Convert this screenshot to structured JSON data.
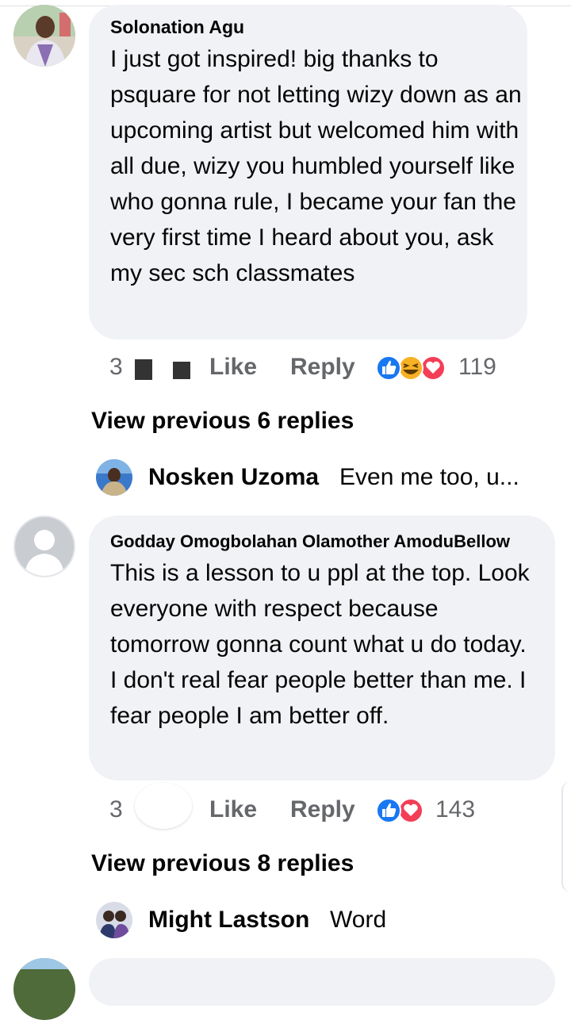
{
  "comments": [
    {
      "author": "Solonation Agu",
      "text": "I just got inspired! big thanks to psquare for not letting wizy down as an upcoming artist but welcomed him with all due, wizy you humbled yourself like who gonna rule, I became your fan the very first time I heard about you, ask my sec sch classmates",
      "time": "3",
      "like_label": "Like",
      "reply_label": "Reply",
      "reaction_count": "119",
      "reactions": [
        "like-icon",
        "haha-icon",
        "love-icon"
      ]
    },
    {
      "author": "Godday Omogbolahan Olamother AmoduBellow",
      "text": "This is a lesson to u ppl at the top. Look everyone with respect because tomorrow gonna count what u do today. I don't real fear people better than me. I fear people I am better off.",
      "time": "3",
      "like_label": "Like",
      "reply_label": "Reply",
      "reaction_count": "143",
      "reactions": [
        "like-icon",
        "love-icon"
      ]
    }
  ],
  "threads": [
    {
      "view_previous": "View previous 6 replies",
      "reply_author": "Nosken Uzoma",
      "reply_text": "Even me too, u..."
    },
    {
      "view_previous": "View previous 8 replies",
      "reply_author": "Might Lastson",
      "reply_text": "Word"
    }
  ],
  "colors": {
    "bubble": "#f0f2f5",
    "meta": "#65676b",
    "like_blue": "#1877f2",
    "love_red": "#f33e58",
    "haha_yellow": "#f7b125"
  }
}
